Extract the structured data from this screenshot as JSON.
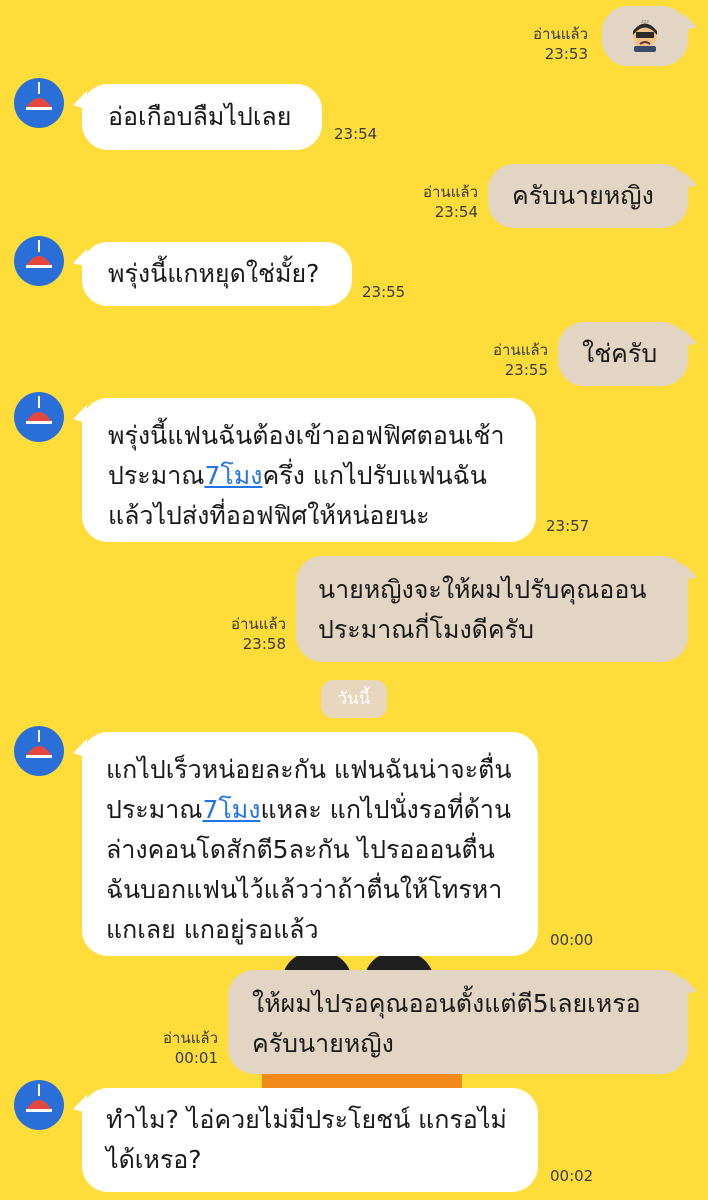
{
  "read_label": "อ่านแล้ว",
  "date_divider": "วันนี้",
  "messages": [
    {
      "side": "out",
      "emoji": "persevering-face",
      "read": "อ่านแล้ว",
      "time": "23:53"
    },
    {
      "side": "in",
      "lines": [
        "อ่อเกือบลืมไปเลย"
      ],
      "time": "23:54"
    },
    {
      "side": "out",
      "lines": [
        "ครับนายหญิง"
      ],
      "read": "อ่านแล้ว",
      "time": "23:54"
    },
    {
      "side": "in",
      "lines": [
        "พรุ่งนี้แกหยุดใช่มั้ย?"
      ],
      "time": "23:55"
    },
    {
      "side": "out",
      "lines": [
        "ใช่ครับ"
      ],
      "read": "อ่านแล้ว",
      "time": "23:55"
    },
    {
      "side": "in",
      "lines": [
        "พรุ่งนี้แฟนฉันต้องเข้าออฟฟิศตอนเช้า",
        "ประมาณ",
        "7โมง",
        "ครึ่ง แกไปรับแฟนฉัน",
        "แล้วไปส่งที่ออฟฟิศให้หน่อยนะ"
      ],
      "time": "23:57"
    },
    {
      "side": "out",
      "lines": [
        "นายหญิงจะให้ผมไปรับคุณออน",
        "ประมาณกี่โมงดีครับ"
      ],
      "read": "อ่านแล้ว",
      "time": "23:58"
    },
    {
      "side": "in",
      "lines": [
        "แกไปเร็วหน่อยละกัน แฟนฉันน่าจะตื่น",
        "ประมาณ",
        "7โมง",
        "แหละ แกไปนั่งรอที่ด้าน",
        "ล่างคอนโดสักตี5ละกัน ไปรอออนตื่น",
        "ฉันบอกแฟนไว้แล้วว่าถ้าตื่นให้โทรหา",
        "แกเลย แกอยู่รอแล้ว"
      ],
      "time": "00:00"
    },
    {
      "side": "out",
      "lines": [
        "ให้ผมไปรอคุณออนตั้งแต่ตี5เลยเหรอ",
        "ครับนายหญิง"
      ],
      "read": "อ่านแล้ว",
      "time": "00:01"
    },
    {
      "side": "in",
      "lines": [
        "ทำไม? ไอ่ควยไม่มีประโยชน์ แกรอไม่",
        "ได้เหรอ?"
      ],
      "time": "00:02"
    }
  ]
}
